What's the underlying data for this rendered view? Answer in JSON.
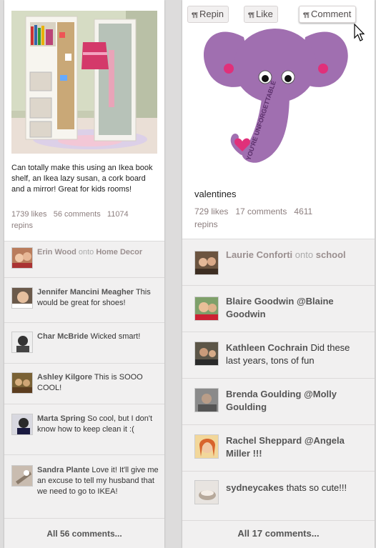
{
  "left_pin": {
    "description": "Can totally make this using an Ikea book shelf, an Ikea lazy susan, a cork board and a mirror! Great for kids rooms!",
    "stats_line1": "1739 likes   56 comments   11074",
    "stats_line2": "repins",
    "comments": [
      {
        "name": "Erin Wood",
        "connector": "onto",
        "text": "Home Decor"
      },
      {
        "name": "Jennifer Mancini Meagher",
        "text": "This would be great for shoes!"
      },
      {
        "name": "Char McBride",
        "text": "Wicked smart!"
      },
      {
        "name": "Ashley Kilgore",
        "text": "This is SOOO COOL!"
      },
      {
        "name": "Marta Spring",
        "text": "So cool, but I don't know how to keep clean it :("
      },
      {
        "name": "Sandra Plante",
        "text": "Love it! It'll give me an excuse to tell my husband that we need to go to IKEA!"
      }
    ],
    "all_comments": "All 56 comments..."
  },
  "right_pin": {
    "actions": {
      "repin": "Repin",
      "like": "Like",
      "comment": "Comment",
      "pin_glyph": "¶¶"
    },
    "image_text": "YOU'RE UNFORGETTABLE",
    "description": "valentines",
    "stats_line1": "729 likes   17 comments   4611",
    "stats_line2": "repins",
    "comments": [
      {
        "name": "Laurie Conforti",
        "connector": "onto",
        "text": "school"
      },
      {
        "name": "Blaire Goodwin",
        "text": "@Blaine Goodwin"
      },
      {
        "name": "Kathleen Cochrain",
        "text": "Did these last years, tons of fun"
      },
      {
        "name": "Brenda Goulding",
        "text": "@Molly Goulding"
      },
      {
        "name": "Rachel Sheppard",
        "text": "@Angela Miller !!!"
      },
      {
        "name": "sydneycakes",
        "text": "thats so cute!!!"
      }
    ],
    "all_comments": "All 17 comments..."
  },
  "colors": {
    "elephant": "#a06fb0",
    "heart": "#e0307a",
    "page_bg": "#dddcdc"
  }
}
